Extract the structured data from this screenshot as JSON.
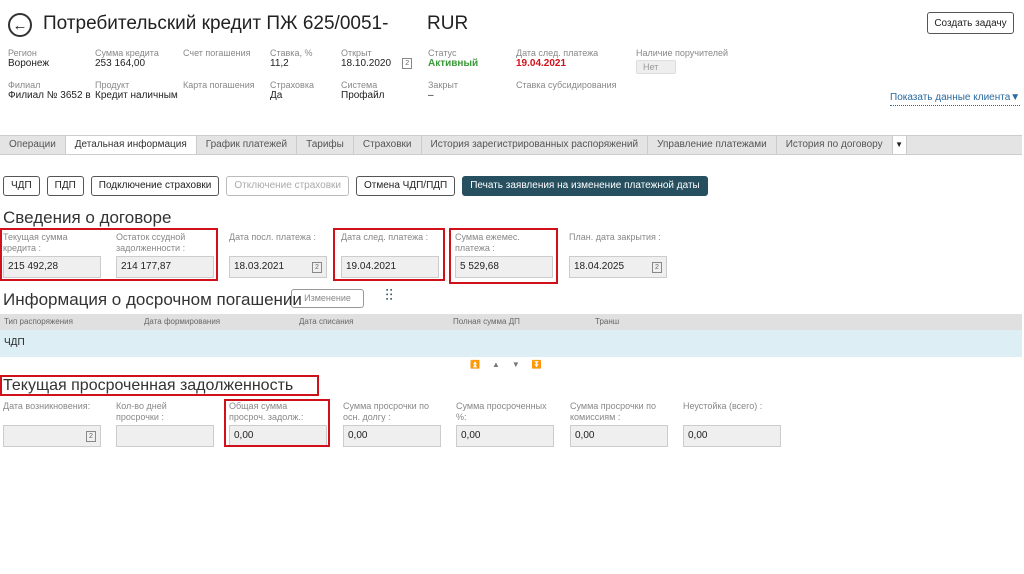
{
  "header": {
    "title": "Потребительский кредит ПЖ 625/0051-",
    "currency": "RUR",
    "create_task": "Создать задачу"
  },
  "info": [
    {
      "label": "Регион",
      "value": "Воронеж"
    },
    {
      "label": "Сумма кредита",
      "value": "253 164,00"
    },
    {
      "label": "Счет погашения",
      "value": ""
    },
    {
      "label": "Ставка, %",
      "value": "11,2"
    },
    {
      "label": "Открыт",
      "value": "18.10.2020"
    },
    {
      "label": "Статус",
      "value": "Активный"
    },
    {
      "label": "Дата след. платежа",
      "value": "19.04.2021"
    },
    {
      "label": "Наличие поручителей",
      "value": "Нет"
    },
    {
      "label": "Филиал",
      "value": "Филиал № 3652 в"
    },
    {
      "label": "Продукт",
      "value": "Кредит наличным"
    },
    {
      "label": "Карта погашения",
      "value": ""
    },
    {
      "label": "Страховка",
      "value": "Да"
    },
    {
      "label": "Система",
      "value": "Профайл"
    },
    {
      "label": "Закрыт",
      "value": "–"
    },
    {
      "label": "Ставка субсидирования",
      "value": ""
    }
  ],
  "show_client": "Показать данные клиента",
  "tabs": [
    "Операции",
    "Детальная информация",
    "График платежей",
    "Тарифы",
    "Страховки",
    "История зарегистрированных распоряжений",
    "Управление платежами",
    "История по договору"
  ],
  "buttons": [
    "ЧДП",
    "ПДП",
    "Подключение страховки",
    "Отключение страховки",
    "Отмена ЧДП/ПДП",
    "Печать заявления на изменение платежной даты"
  ],
  "contract": {
    "title": "Сведения о договоре",
    "fields": [
      {
        "label": "Текущая сумма кредита :",
        "value": "215 492,28"
      },
      {
        "label": "Остаток ссудной задолженности :",
        "value": "214 177,87"
      },
      {
        "label": "Дата посл. платежа :",
        "value": "18.03.2021"
      },
      {
        "label": "Дата след. платежа :",
        "value": "19.04.2021"
      },
      {
        "label": "Сумма ежемес. платежа :",
        "value": "5 529,68"
      },
      {
        "label": "План. дата закрытия :",
        "value": "18.04.2025"
      }
    ]
  },
  "early": {
    "title": "Информация о досрочном погашении",
    "change": "Изменение",
    "columns": [
      "Тип распоряжения",
      "Дата формирования",
      "Дата списания",
      "Полная сумма ДП",
      "Транш"
    ],
    "rows": [
      [
        "ЧДП"
      ]
    ]
  },
  "overdue": {
    "title": "Текущая просроченная задолженность",
    "fields": [
      {
        "label": "Дата возникновения:",
        "value": ""
      },
      {
        "label": "Кол-во дней просрочки :",
        "value": ""
      },
      {
        "label": "Общая сумма просроч. задолж.:",
        "value": "0,00"
      },
      {
        "label": "Сумма просрочки по осн. долгу :",
        "value": "0,00"
      },
      {
        "label": "Сумма просроченных %:",
        "value": "0,00"
      },
      {
        "label": "Сумма просрочки по комиссиям :",
        "value": "0,00"
      },
      {
        "label": "Неустойка (всего) :",
        "value": "0,00"
      }
    ]
  },
  "colors": {
    "accent": "#264f5f",
    "highlight": "#d0101a",
    "active": "#3a9a3a"
  }
}
